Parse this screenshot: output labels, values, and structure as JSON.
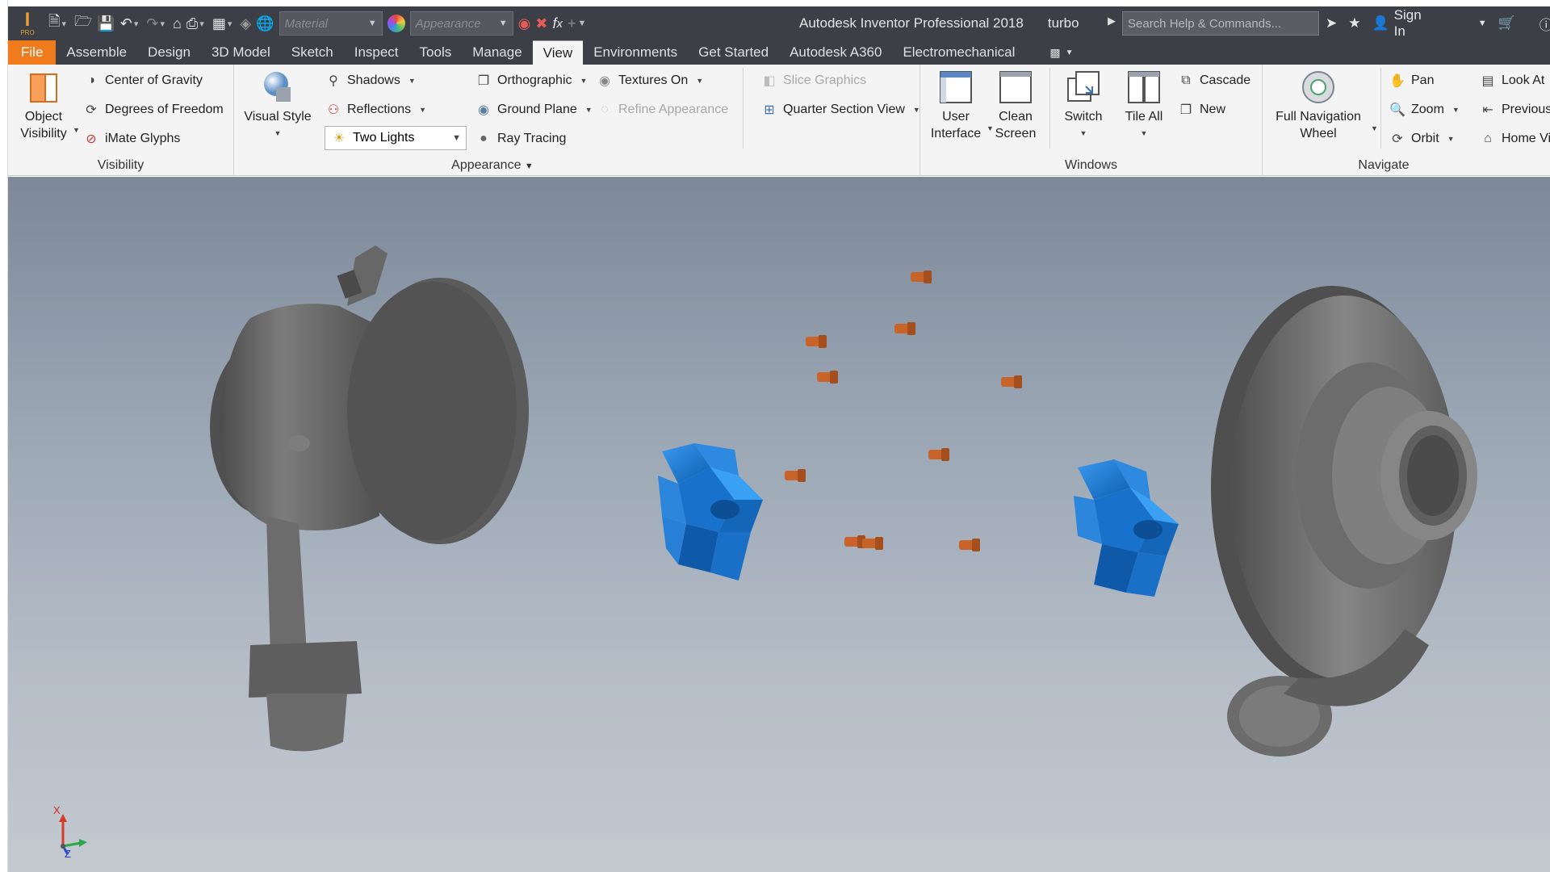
{
  "app": {
    "title": "Autodesk Inventor Professional 2018",
    "document": "turbo",
    "logo_letter": "I",
    "logo_sub": "PRO"
  },
  "quick_access": {
    "material_placeholder": "Material",
    "appearance_placeholder": "Appearance",
    "search_placeholder": "Search Help & Commands...",
    "sign_in": "Sign In"
  },
  "tabs": [
    {
      "label": "File"
    },
    {
      "label": "Assemble"
    },
    {
      "label": "Design"
    },
    {
      "label": "3D Model"
    },
    {
      "label": "Sketch"
    },
    {
      "label": "Inspect"
    },
    {
      "label": "Tools"
    },
    {
      "label": "Manage"
    },
    {
      "label": "View"
    },
    {
      "label": "Environments"
    },
    {
      "label": "Get Started"
    },
    {
      "label": "Autodesk A360"
    },
    {
      "label": "Electromechanical"
    }
  ],
  "active_tab": "View",
  "ribbon": {
    "visibility": {
      "title": "Visibility",
      "object_visibility_line1": "Object",
      "object_visibility_line2": "Visibility",
      "center_of_gravity": "Center of Gravity",
      "degrees_of_freedom": "Degrees of Freedom",
      "imate_glyphs": "iMate Glyphs"
    },
    "appearance": {
      "title": "Appearance",
      "visual_style": "Visual Style",
      "shadows": "Shadows",
      "reflections": "Reflections",
      "lighting": "Two Lights",
      "orthographic": "Orthographic",
      "ground_plane": "Ground Plane",
      "ray_tracing": "Ray Tracing",
      "textures_on": "Textures On",
      "refine_appearance": "Refine Appearance",
      "slice_graphics": "Slice Graphics",
      "quarter_section_view": "Quarter Section View"
    },
    "windows": {
      "title": "Windows",
      "user_interface_line1": "User",
      "user_interface_line2": "Interface",
      "clean_screen_line1": "Clean",
      "clean_screen_line2": "Screen",
      "switch": "Switch",
      "tile_all": "Tile All",
      "cascade": "Cascade",
      "new": "New"
    },
    "navigate": {
      "title": "Navigate",
      "full_nav_line1": "Full Navigation",
      "full_nav_line2": "Wheel",
      "pan": "Pan",
      "zoom": "Zoom",
      "orbit": "Orbit",
      "look_at": "Look At",
      "previous": "Previous",
      "home_view": "Home Vie"
    }
  },
  "viewport": {
    "triad_x": "X",
    "triad_z": "Z",
    "colors": {
      "housing": "#5e5f5e",
      "impeller": "#1f78d1",
      "bolt": "#c8642a"
    }
  }
}
